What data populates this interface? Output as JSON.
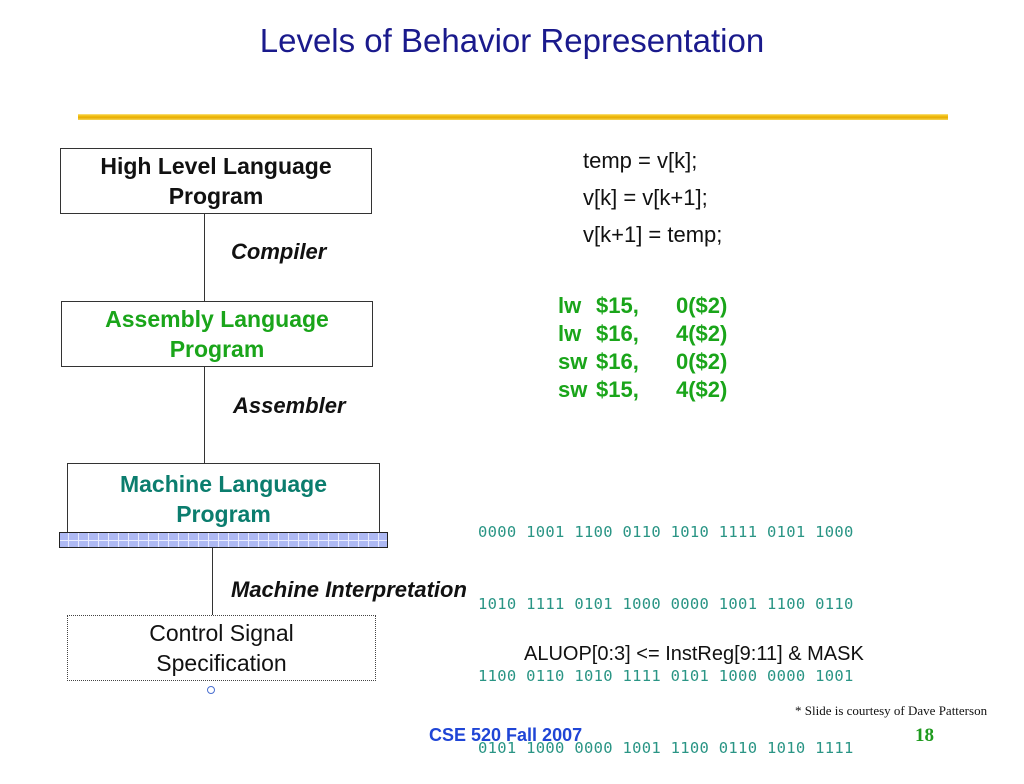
{
  "slide": {
    "title": "Levels of Behavior Representation",
    "levels": [
      {
        "line1": "High Level Language",
        "line2": "Program"
      },
      {
        "line1": "Assembly  Language",
        "line2": "Program"
      },
      {
        "line1": "Machine  Language",
        "line2": "Program"
      },
      {
        "line1": "Control Signal",
        "line2": "Specification"
      }
    ],
    "transitions": [
      "Compiler",
      "Assembler",
      "Machine Interpretation"
    ],
    "high_level_code": [
      "temp = v[k];",
      "v[k] = v[k+1];",
      "v[k+1] = temp;"
    ],
    "assembly_code": [
      {
        "op": "lw",
        "reg": "$15,",
        "addr": "0($2)"
      },
      {
        "op": "lw",
        "reg": "$16,",
        "addr": "4($2)"
      },
      {
        "op": "sw",
        "reg": "$16,",
        "addr": "0($2)"
      },
      {
        "op": "sw",
        "reg": "$15,",
        "addr": "4($2)"
      }
    ],
    "machine_code": [
      "0000 1001 1100 0110 1010 1111 0101 1000",
      "1010 1111 0101 1000 0000 1001 1100 0110",
      "1100 0110 1010 1111 0101 1000 0000 1001",
      "0101 1000 0000 1001 1100 0110 1010 1111"
    ],
    "control_signal": "ALUOP[0:3] <= InstReg[9:11] & MASK",
    "courtesy": "* Slide is courtesy of Dave Patterson",
    "course": "CSE 520 Fall 2007",
    "page_number": "18"
  },
  "colors": {
    "title": "#1a1a8c",
    "assembly": "#1aa51a",
    "machine": "#0b7d6e",
    "binary": "#2a9585",
    "course": "#1f45d6",
    "page_number": "#1e9a1e",
    "rule": "#f2c012"
  }
}
